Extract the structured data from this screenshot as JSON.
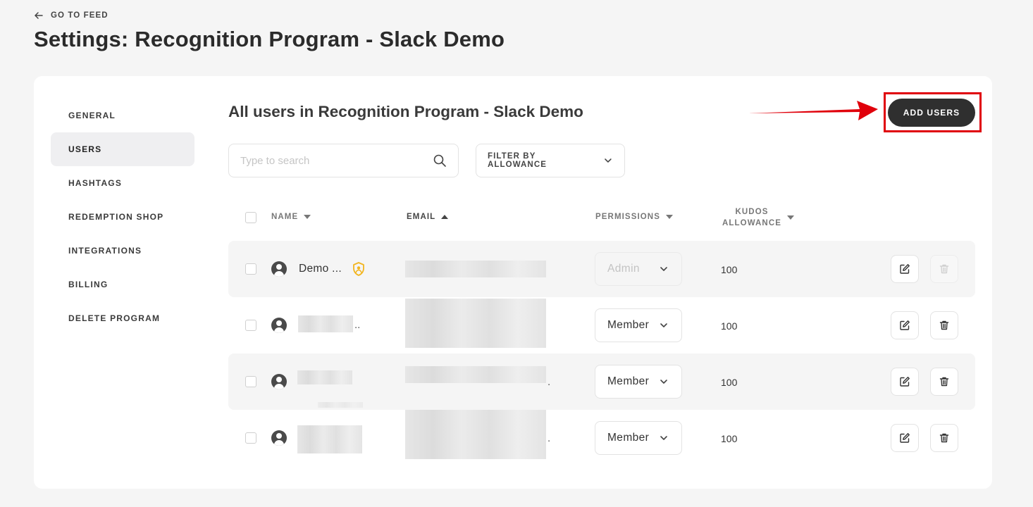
{
  "back_link": "GO TO FEED",
  "page_title": "Settings: Recognition Program - Slack Demo",
  "sidebar": {
    "items": [
      {
        "label": "GENERAL",
        "active": false
      },
      {
        "label": "USERS",
        "active": true
      },
      {
        "label": "HASHTAGS",
        "active": false
      },
      {
        "label": "REDEMPTION SHOP",
        "active": false
      },
      {
        "label": "INTEGRATIONS",
        "active": false
      },
      {
        "label": "BILLING",
        "active": false
      },
      {
        "label": "DELETE PROGRAM",
        "active": false
      }
    ]
  },
  "section_title": "All users in Recognition Program - Slack Demo",
  "add_users_label": "ADD USERS",
  "search": {
    "placeholder": "Type to search",
    "value": ""
  },
  "filter_label": "FILTER BY ALLOWANCE",
  "table": {
    "headers": {
      "name": "NAME",
      "email": "EMAIL",
      "permissions": "PERMISSIONS",
      "kudos_line1": "KUDOS",
      "kudos_line2": "ALLOWANCE"
    },
    "rows": [
      {
        "name": "Demo ...",
        "admin_badge": true,
        "permission": "Admin",
        "permission_disabled": true,
        "allowance": "100",
        "delete_disabled": true
      },
      {
        "name": "",
        "suffix": "..",
        "permission": "Member",
        "permission_disabled": false,
        "allowance": "100",
        "delete_disabled": false
      },
      {
        "name": "",
        "permission": "Member",
        "permission_disabled": false,
        "allowance": "100",
        "delete_disabled": false
      },
      {
        "name": "",
        "permission": "Member",
        "permission_disabled": false,
        "allowance": "100",
        "delete_disabled": false
      }
    ]
  },
  "colors": {
    "accent_dark": "#2f2f2f",
    "highlight_red": "#e0000b",
    "admin_badge": "#f2b51f"
  },
  "icons": [
    "arrow-left-icon",
    "search-icon",
    "chevron-down-icon",
    "user-avatar-icon",
    "admin-shield-icon",
    "edit-icon",
    "trash-icon"
  ]
}
